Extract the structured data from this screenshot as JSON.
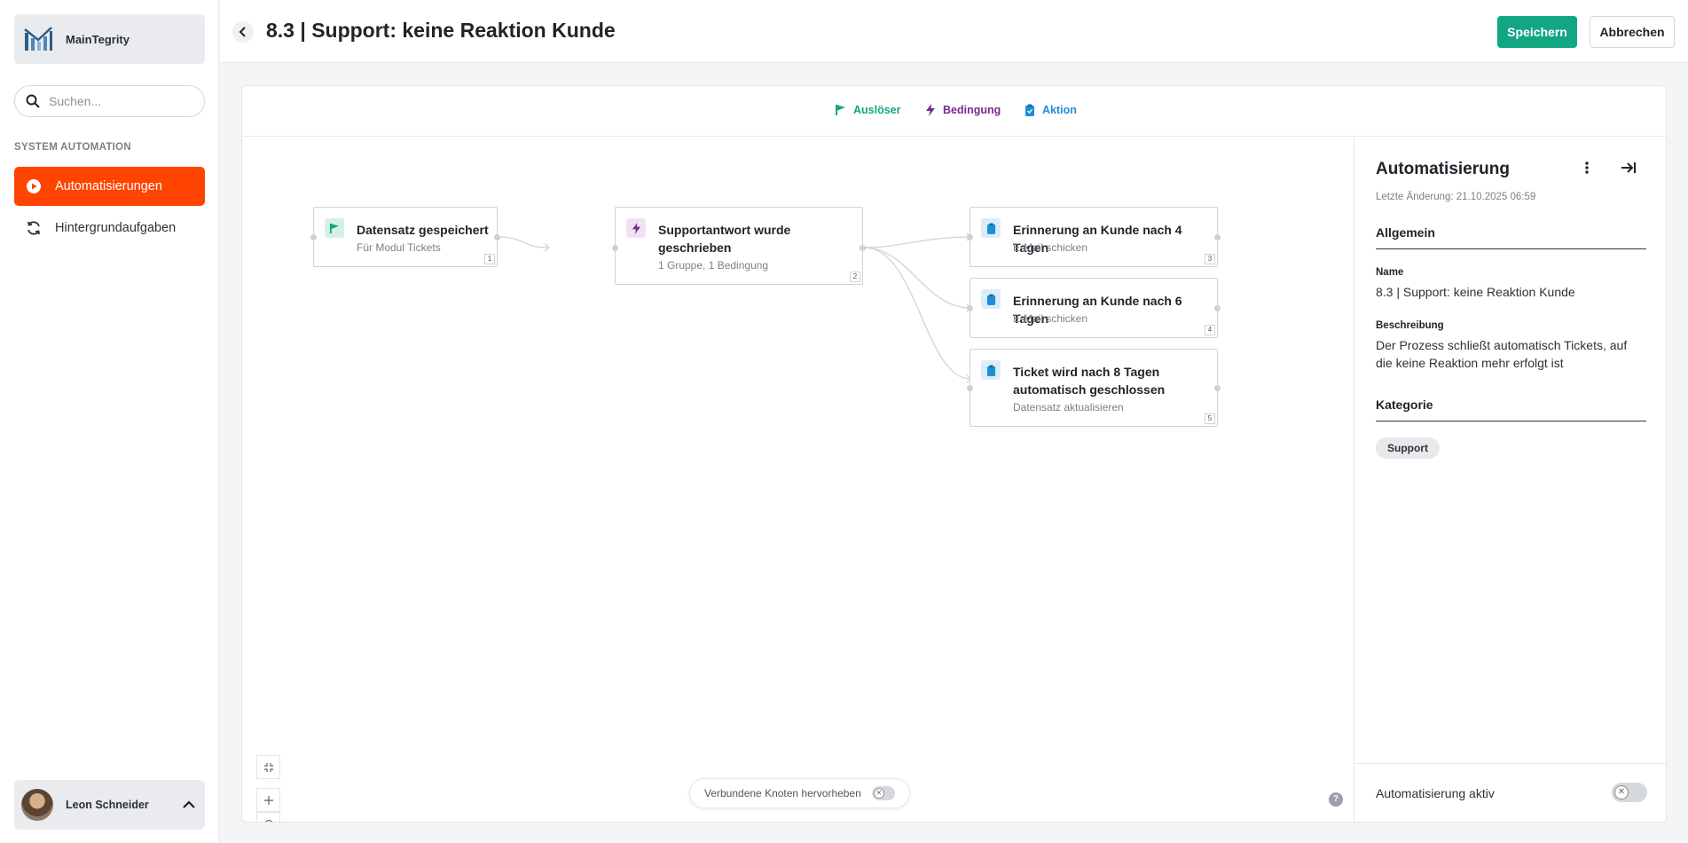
{
  "app": {
    "name": "MainTegrity"
  },
  "search": {
    "placeholder": "Suchen..."
  },
  "sidebar": {
    "section_label": "SYSTEM AUTOMATION",
    "items": [
      {
        "label": "Automatisierungen",
        "icon": "play-circle-icon",
        "active": true
      },
      {
        "label": "Hintergrundaufgaben",
        "icon": "refresh-icon",
        "active": false
      }
    ]
  },
  "user": {
    "name": "Leon Schneider"
  },
  "header": {
    "title": "8.3 | Support: keine Reaktion Kunde",
    "save_label": "Speichern",
    "cancel_label": "Abbrechen"
  },
  "legend": {
    "trigger": {
      "label": "Auslöser",
      "color": "#12a683",
      "icon": "flag-icon"
    },
    "condition": {
      "label": "Bedingung",
      "color": "#7a2a8f",
      "icon": "lightning-icon"
    },
    "action": {
      "label": "Aktion",
      "color": "#1c8fd6",
      "icon": "clipboard-icon"
    }
  },
  "nodes": [
    {
      "title": "Datensatz gespeichert",
      "subtitle": "Für Modul Tickets",
      "number": "1",
      "type": "trigger"
    },
    {
      "title": "Supportantwort wurde geschrieben",
      "subtitle": "1 Gruppe, 1 Bedingung",
      "number": "2",
      "type": "condition"
    },
    {
      "title": "Erinnerung an Kunde nach 4 Tagen",
      "subtitle": "E-Mail schicken",
      "number": "3",
      "type": "action"
    },
    {
      "title": "Erinnerung an Kunde nach 6 Tagen",
      "subtitle": "E-Mail schicken",
      "number": "4",
      "type": "action"
    },
    {
      "title": "Ticket wird nach 8 Tagen automatisch geschlossen",
      "subtitle": "Datensatz aktualisieren",
      "number": "5",
      "type": "action"
    }
  ],
  "canvas": {
    "highlight_toggle_label": "Verbundene Knoten hervorheben",
    "highlight_toggle_on": false,
    "help_label": "?"
  },
  "panel": {
    "title": "Automatisierung",
    "last_change": "Letzte Änderung: 21.10.2025 06:59",
    "general_heading": "Allgemein",
    "name_label": "Name",
    "name_value": "8.3 | Support: keine Reaktion Kunde",
    "description_label": "Beschreibung",
    "description_value": "Der Prozess schließt automatisch Tickets, auf die keine Reaktion mehr erfolgt ist",
    "category_heading": "Kategorie",
    "category_tag": "Support",
    "active_label": "Automatisierung aktiv",
    "active": false
  }
}
